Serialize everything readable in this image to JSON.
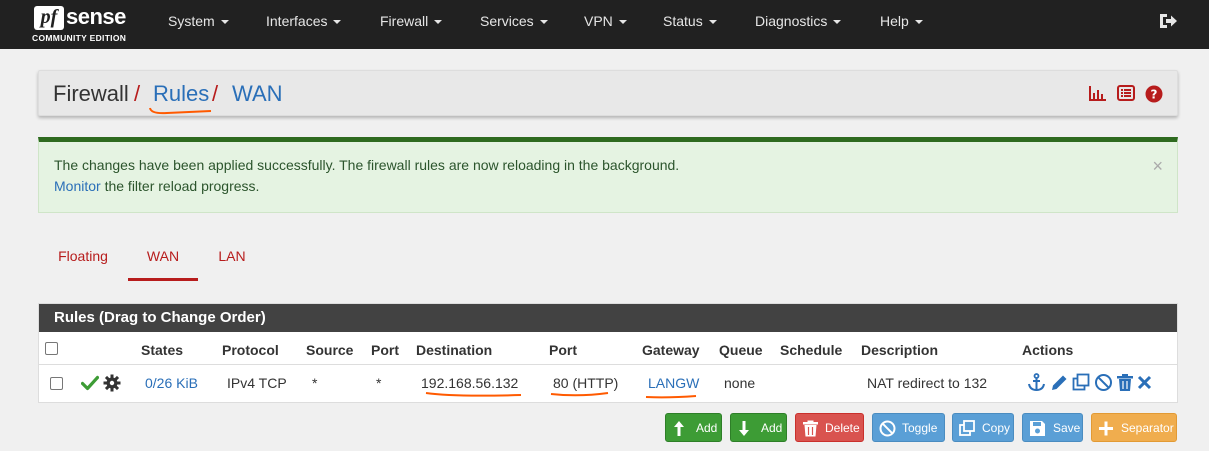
{
  "navbar": {
    "logo_mark": "pf",
    "logo_word": "sense",
    "logo_edition": "COMMUNITY EDITION",
    "items": [
      {
        "label": "System"
      },
      {
        "label": "Interfaces"
      },
      {
        "label": "Firewall"
      },
      {
        "label": "Services"
      },
      {
        "label": "VPN"
      },
      {
        "label": "Status"
      },
      {
        "label": "Diagnostics"
      },
      {
        "label": "Help"
      }
    ],
    "logout_icon": "sign-out-icon"
  },
  "breadcrumb": {
    "part1": "Firewall",
    "sep1": "/",
    "part2": "Rules",
    "sep2": "/",
    "part3": "WAN",
    "icons": [
      "bar-chart-icon",
      "list-icon",
      "help-icon"
    ]
  },
  "alert": {
    "message": "The changes have been applied successfully. The firewall rules are now reloading in the background.",
    "link": "Monitor",
    "message2": " the filter reload progress.",
    "close": "×"
  },
  "tabs": [
    {
      "label": "Floating",
      "active": false
    },
    {
      "label": "WAN",
      "active": true
    },
    {
      "label": "LAN",
      "active": false
    }
  ],
  "rules_panel": {
    "title": "Rules (Drag to Change Order)",
    "columns": {
      "states": "States",
      "protocol": "Protocol",
      "source": "Source",
      "port": "Port",
      "destination": "Destination",
      "dest_port": "Port",
      "gateway": "Gateway",
      "queue": "Queue",
      "schedule": "Schedule",
      "description": "Description",
      "actions": "Actions"
    },
    "rows": [
      {
        "states": "0/26 KiB",
        "protocol": "IPv4 TCP",
        "source": "*",
        "port": "*",
        "destination": "192.168.56.132",
        "dest_port": "80 (HTTP)",
        "gateway": "LANGW",
        "queue": "none",
        "schedule": "",
        "description": "NAT redirect to 132"
      }
    ]
  },
  "buttons": {
    "add_top": "Add",
    "add_bottom": "Add",
    "delete": "Delete",
    "toggle": "Toggle",
    "copy": "Copy",
    "save": "Save",
    "separator": "Separator"
  },
  "colors": {
    "navbar": "#212121",
    "accent_red": "#b71c1c",
    "link_blue": "#2a6fb8",
    "success_green": "#3d9c35",
    "annotation_orange": "#ff5a00"
  }
}
